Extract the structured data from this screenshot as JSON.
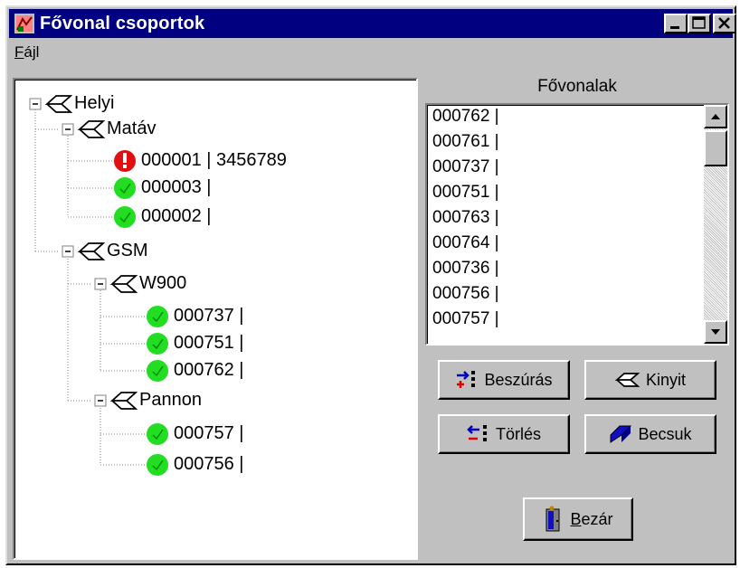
{
  "window": {
    "title": "Fővonal csoportok"
  },
  "menu": {
    "file_label": "Fájl",
    "file_underline": "F",
    "file_rest": "ájl"
  },
  "tree": {
    "root": "Helyi",
    "groups": [
      {
        "label": "Matáv",
        "items": [
          {
            "label": "000001 | 3456789",
            "status": "error"
          },
          {
            "label": "000003 |",
            "status": "ok"
          },
          {
            "label": "000002 |",
            "status": "ok"
          }
        ]
      },
      {
        "label": "GSM",
        "subgroups": [
          {
            "label": "W900",
            "items": [
              {
                "label": "000737 |",
                "status": "ok"
              },
              {
                "label": "000751 |",
                "status": "ok"
              },
              {
                "label": "000762 |",
                "status": "ok"
              }
            ]
          },
          {
            "label": "Pannon",
            "items": [
              {
                "label": "000757 |",
                "status": "ok"
              },
              {
                "label": "000756 |",
                "status": "ok"
              }
            ]
          }
        ]
      }
    ]
  },
  "lines_panel": {
    "title": "Fővonalak",
    "items": [
      "000762 |",
      "000761 |",
      "000737 |",
      "000751 |",
      "000763 |",
      "000764 |",
      "000736 |",
      "000756 |",
      "000757 |"
    ]
  },
  "buttons": {
    "insert": "Beszúrás",
    "open": "Kinyit",
    "delete": "Törlés",
    "close_group": "Becsuk",
    "close_window": "Bezár",
    "close_window_underline": "B",
    "close_window_rest": "ezár"
  },
  "colors": {
    "titlebar": "#000080",
    "ok": "#22dd22",
    "error": "#e01010"
  }
}
